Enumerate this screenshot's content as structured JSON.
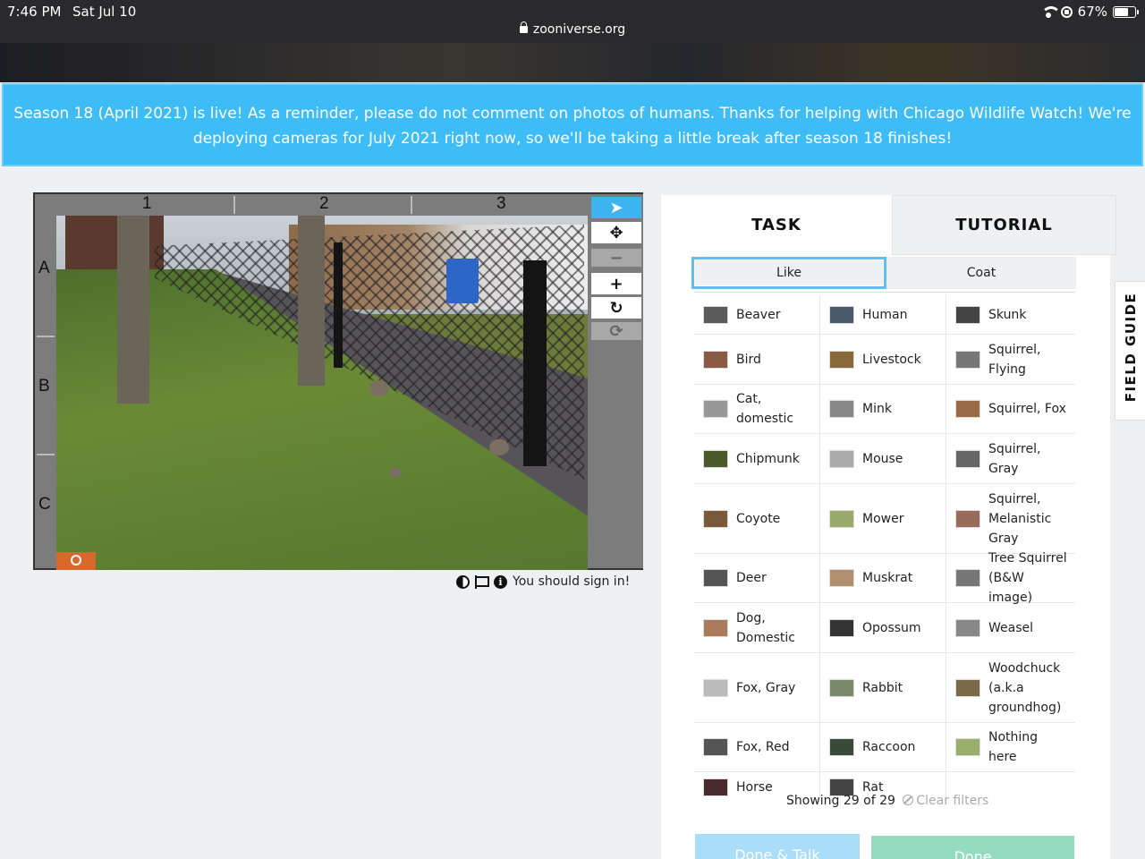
{
  "status_bar": {
    "time": "7:46 PM",
    "date": "Sat Jul 10",
    "url": "zooniverse.org",
    "battery": "67%",
    "battery_level": 0.67
  },
  "announcement": "Season 18 (April 2021) is live! As a reminder, please do not comment on photos of humans. Thanks for helping with Chicago Wildlife Watch! We're deploying cameras for July 2021 right now, so we'll be taking a little break after season 18 finishes!",
  "viewer": {
    "columns": [
      "1",
      "2",
      "3"
    ],
    "rows": [
      "A",
      "B",
      "C"
    ],
    "sign_in_text": "You should sign in!"
  },
  "toolbar": {
    "items": [
      {
        "name": "pointer-tool",
        "glyph": "➤",
        "state": "active"
      },
      {
        "name": "move-tool",
        "glyph": "✥",
        "state": "normal"
      },
      {
        "name": "zoom-out-button",
        "glyph": "−",
        "state": "disabled"
      },
      {
        "name": "zoom-in-button",
        "glyph": "+",
        "state": "normal"
      },
      {
        "name": "rotate-button",
        "glyph": "↻",
        "state": "normal"
      },
      {
        "name": "reset-button",
        "glyph": "⟳",
        "state": "disabled"
      }
    ]
  },
  "panel": {
    "tabs": {
      "task": "TASK",
      "tutorial": "TUTORIAL"
    },
    "filters": {
      "like": "Like",
      "coat": "Coat"
    },
    "choices": [
      [
        {
          "label": "Beaver",
          "thumb": "#5a5a5a"
        },
        {
          "label": "Human",
          "thumb": "#4a5a6a"
        },
        {
          "label": "Skunk",
          "thumb": "#444"
        }
      ],
      [
        {
          "label": "Bird",
          "thumb": "#8a5a44"
        },
        {
          "label": "Livestock",
          "thumb": "#8a6a3a"
        },
        {
          "label": "Squirrel, Flying",
          "thumb": "#777"
        }
      ],
      [
        {
          "label": "Cat, domestic",
          "thumb": "#999"
        },
        {
          "label": "Mink",
          "thumb": "#888"
        },
        {
          "label": "Squirrel, Fox",
          "thumb": "#9a6a44"
        }
      ],
      [
        {
          "label": "Chipmunk",
          "thumb": "#4a5a2a"
        },
        {
          "label": "Mouse",
          "thumb": "#aaa"
        },
        {
          "label": "Squirrel, Gray",
          "thumb": "#666"
        }
      ],
      [
        {
          "label": "Coyote",
          "thumb": "#7a5a3a"
        },
        {
          "label": "Mower",
          "thumb": "#9aaa6a"
        },
        {
          "label": "Squirrel, Melanistic Gray",
          "thumb": "#9a6a5a"
        }
      ],
      [
        {
          "label": "Deer",
          "thumb": "#555"
        },
        {
          "label": "Muskrat",
          "thumb": "#b09070"
        },
        {
          "label": "Tree Squirrel (B&W image)",
          "thumb": "#777"
        }
      ],
      [
        {
          "label": "Dog, Domestic",
          "thumb": "#aa7a5a"
        },
        {
          "label": "Opossum",
          "thumb": "#333"
        },
        {
          "label": "Weasel",
          "thumb": "#888"
        }
      ],
      [
        {
          "label": "Fox, Gray",
          "thumb": "#bbb"
        },
        {
          "label": "Rabbit",
          "thumb": "#7a8a6a"
        },
        {
          "label": "Woodchuck (a.k.a groundhog)",
          "thumb": "#7a6a4a"
        }
      ],
      [
        {
          "label": "Fox, Red",
          "thumb": "#555"
        },
        {
          "label": "Raccoon",
          "thumb": "#3a4a3a"
        },
        {
          "label": "Nothing here",
          "thumb": "#9ab06a"
        }
      ],
      [
        {
          "label": "Horse",
          "thumb": "#4a2a2a"
        },
        {
          "label": "Rat",
          "thumb": "#444"
        },
        {
          "label": "",
          "thumb": ""
        }
      ]
    ],
    "showing": "Showing 29 of 29",
    "clear_filters": "Clear filters",
    "done_talk": "Done & Talk",
    "done": "Done"
  },
  "field_guide": "FIELD GUIDE",
  "colors": {
    "announcement_bg": "#3ebcf5",
    "active_tool": "#3eb5f1",
    "done_talk": "#a9ddf8",
    "done": "#93dcbf"
  }
}
